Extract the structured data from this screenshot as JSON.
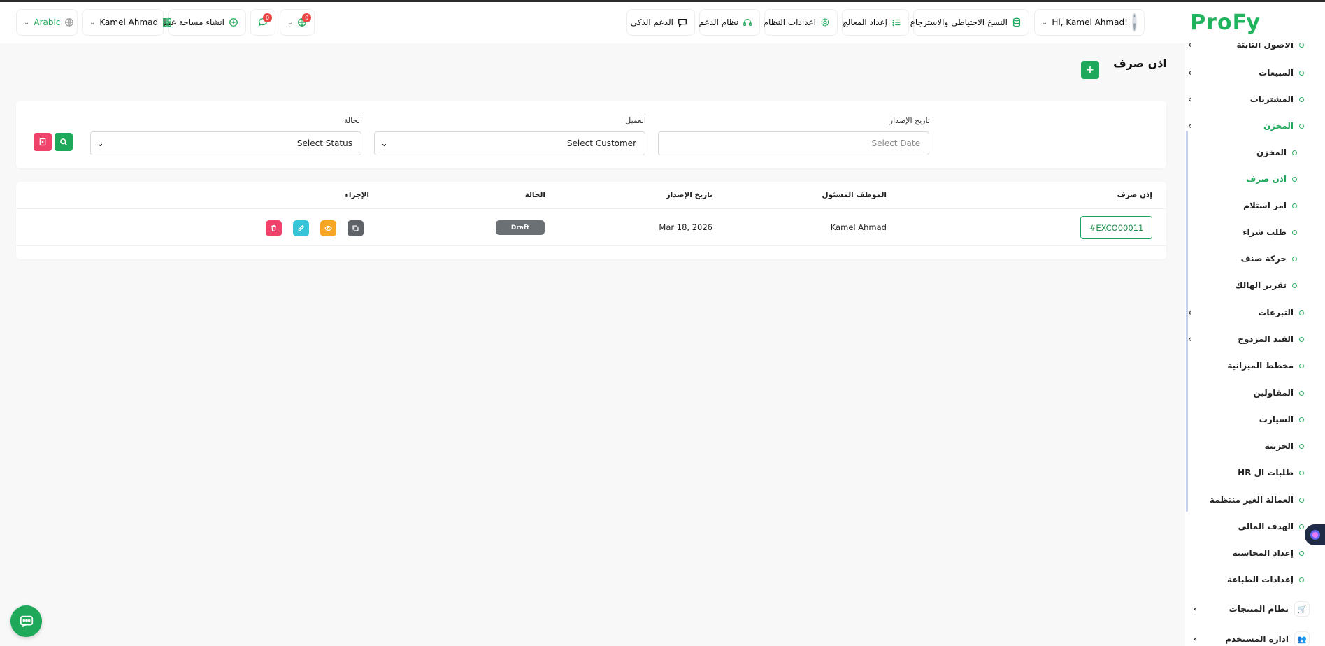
{
  "brand": {
    "name": "ProFy",
    "color": "#22b35e"
  },
  "header": {
    "greeting": "Hi, Kamel Ahmad!",
    "backup": "النسخ الاحتياطي والاسترجاع",
    "wizard": "إعداد المعالج",
    "system_settings": "اعدادات النظام",
    "support": "نظام الدعم",
    "ai_support": "الدعم الذكي",
    "globe_badge": "0",
    "chat_badge": "0",
    "create_workspace": "انشاء مساحة عمل",
    "workspace_user": "Kamel Ahmad",
    "language": "Arabic"
  },
  "sidebar": {
    "items": [
      {
        "label": "الأصول الثابتة",
        "type": "group"
      },
      {
        "label": "المبيعات",
        "type": "group"
      },
      {
        "label": "المشتريات",
        "type": "group"
      },
      {
        "label": "المخزن",
        "type": "group",
        "active": true
      },
      {
        "label": "المخزن",
        "type": "sub"
      },
      {
        "label": "اذن صرف",
        "type": "sub",
        "active": true
      },
      {
        "label": "امر استلام",
        "type": "sub"
      },
      {
        "label": "طلب شراء",
        "type": "sub"
      },
      {
        "label": "حركة صنف",
        "type": "sub"
      },
      {
        "label": "تقرير الهالك",
        "type": "sub"
      },
      {
        "label": "التبرعات",
        "type": "group"
      },
      {
        "label": "القيد المزدوج",
        "type": "group"
      },
      {
        "label": "مخطط الميزانية",
        "type": "single"
      },
      {
        "label": "المقاولين",
        "type": "single"
      },
      {
        "label": "السيارت",
        "type": "single"
      },
      {
        "label": "الخزينة",
        "type": "single"
      },
      {
        "label": "طلبات ال HR",
        "type": "single"
      },
      {
        "label": "العمالة الغير منتظمة",
        "type": "single"
      },
      {
        "label": "الهدف المالى",
        "type": "single"
      },
      {
        "label": "إعداد المحاسبة",
        "type": "single"
      },
      {
        "label": "إعدادات الطباعة",
        "type": "single"
      },
      {
        "label": "نظام المنتجات",
        "type": "icon-group"
      },
      {
        "label": "ادارة المستخدم",
        "type": "icon-group"
      }
    ]
  },
  "page": {
    "title": "اذن صرف"
  },
  "filters": {
    "date_label": "تاريخ الإصدار",
    "date_placeholder": "Select Date",
    "customer_label": "العميل",
    "customer_value": "Select Customer",
    "status_label": "الحالة",
    "status_value": "Select Status"
  },
  "table": {
    "headers": {
      "voucher": "إذن صرف",
      "employee": "الموظف المسئول",
      "date": "تاريخ الإصدار",
      "status": "الحالة",
      "action": "الإجراء"
    },
    "rows": [
      {
        "code": "#EXCO00011",
        "employee": "Kamel Ahmad",
        "date": "Mar 18, 2026",
        "status": "Draft"
      }
    ]
  },
  "colors": {
    "primary": "#1ea85a",
    "danger": "#f0436b",
    "warning": "#f5a623",
    "info": "#36c5d8",
    "secondary": "#5f6368",
    "draft": "#6b7075"
  },
  "icons": [
    "database-icon",
    "list-check-icon",
    "gear-icon",
    "headset-icon",
    "chat-icon",
    "globe-icon",
    "message-icon",
    "plus-circle-icon",
    "apps-icon",
    "language-icon",
    "search-icon",
    "clear-filter-icon",
    "copy-icon",
    "eye-icon",
    "edit-icon",
    "trash-icon",
    "cart-icon",
    "users-icon"
  ]
}
